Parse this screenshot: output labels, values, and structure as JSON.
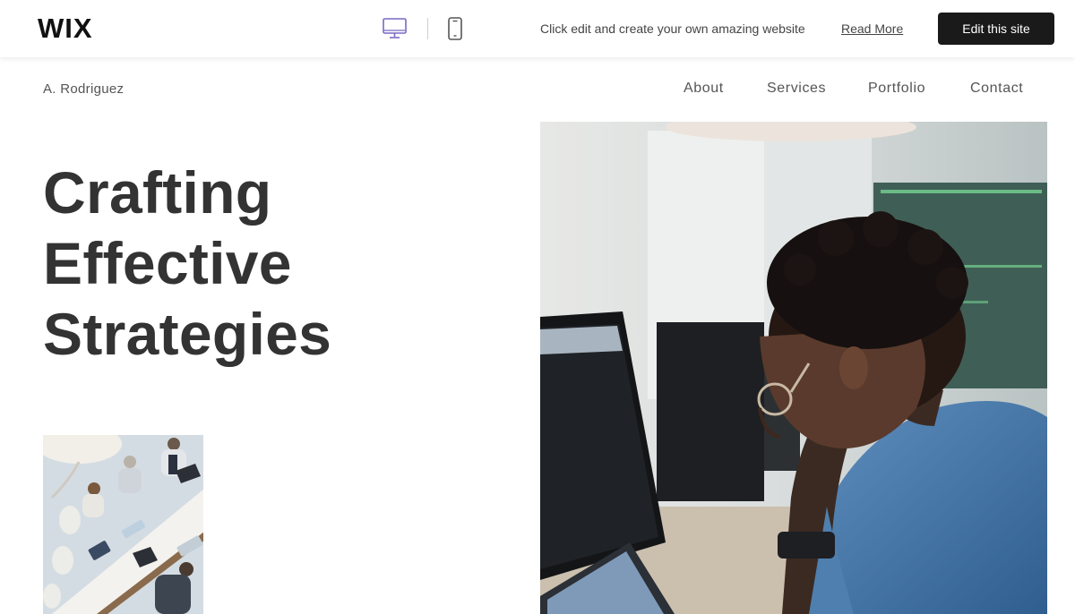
{
  "wixbar": {
    "logo": "WIX",
    "message": "Click edit and create your own amazing website",
    "read_more": "Read More",
    "edit_button": "Edit this site",
    "accent_color": "#7a68c4"
  },
  "site": {
    "name": "A. Rodriguez",
    "nav": [
      "About",
      "Services",
      "Portfolio",
      "Contact"
    ]
  },
  "hero": {
    "title_lines": [
      "Crafting",
      "Effective",
      "Strategies"
    ]
  },
  "images": {
    "small": "meeting-photo",
    "large": "man-at-computer-photo"
  }
}
